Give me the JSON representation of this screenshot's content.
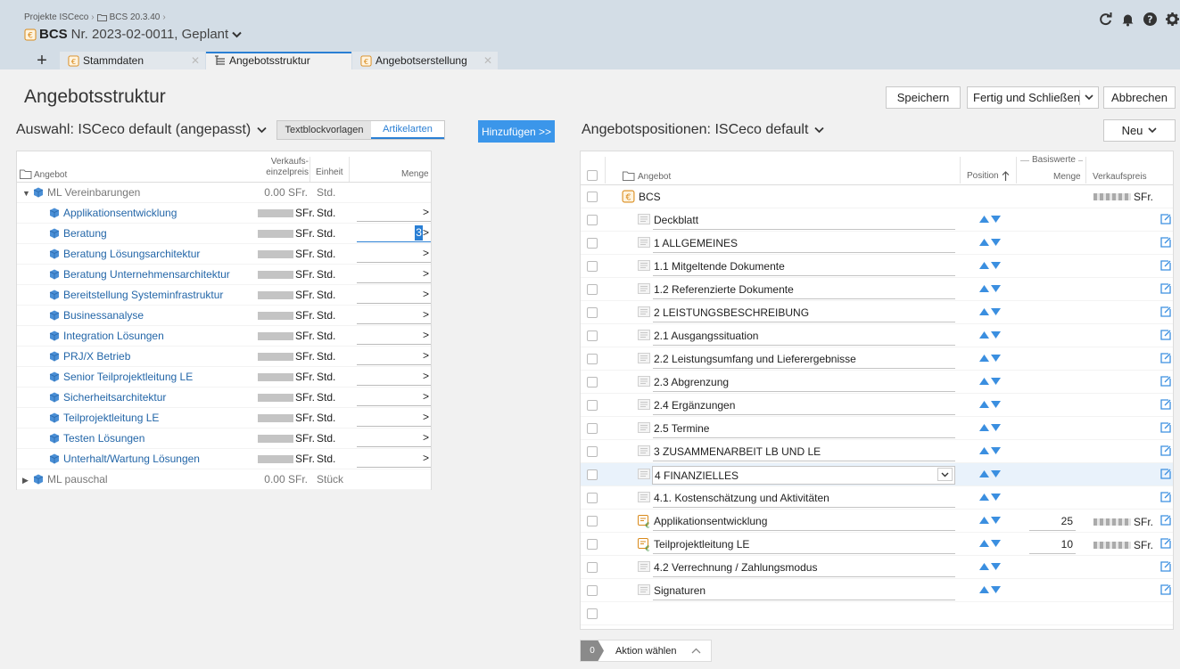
{
  "breadcrumb": {
    "items": [
      "Projekte ISCeco",
      "BCS 20.3.40"
    ]
  },
  "project": {
    "label": "BCS",
    "title": "Nr. 2023-02-0011, Geplant"
  },
  "header_icons": [
    "refresh-icon",
    "bell-icon",
    "help-icon",
    "gear-icon"
  ],
  "tabs": [
    {
      "label": "Stammdaten",
      "active": false
    },
    {
      "label": "Angebotsstruktur",
      "active": true
    },
    {
      "label": "Angebotserstellung",
      "active": false
    }
  ],
  "page": {
    "title": "Angebotsstruktur",
    "buttons": {
      "save": "Speichern",
      "finish": "Fertig und Schließen",
      "cancel": "Abbrechen"
    }
  },
  "left": {
    "selection_label": "Auswahl: ISCeco default (angepasst)",
    "segments": [
      "Textblockvorlagen",
      "Artikelarten"
    ],
    "active_segment": "Artikelarten",
    "add_button": "Hinzufügen >>",
    "columns": {
      "name": "Angebot",
      "price_1": "Verkaufs-",
      "price_2": "einzelpreis",
      "unit": "Einheit",
      "qty": "Menge"
    },
    "groups": [
      {
        "name": "ML Vereinbarungen",
        "price": "0.00 SFr.",
        "unit": "Std.",
        "expanded": true,
        "items": [
          {
            "name": "Applikationsentwicklung",
            "price_suffix": "SFr.",
            "unit": "Std.",
            "qty": ""
          },
          {
            "name": "Beratung",
            "price_suffix": "SFr.",
            "unit": "Std.",
            "qty": "3"
          },
          {
            "name": "Beratung Lösungsarchitektur",
            "price_suffix": "SFr.",
            "unit": "Std.",
            "qty": ""
          },
          {
            "name": "Beratung Unternehmensarchitektur",
            "price_suffix": "SFr.",
            "unit": "Std.",
            "qty": ""
          },
          {
            "name": "Bereitstellung Systeminfrastruktur",
            "price_suffix": "SFr.",
            "unit": "Std.",
            "qty": ""
          },
          {
            "name": "Businessanalyse",
            "price_suffix": "SFr.",
            "unit": "Std.",
            "qty": ""
          },
          {
            "name": "Integration Lösungen",
            "price_suffix": "SFr.",
            "unit": "Std.",
            "qty": ""
          },
          {
            "name": "PRJ/X Betrieb",
            "price_suffix": "SFr.",
            "unit": "Std.",
            "qty": ""
          },
          {
            "name": "Senior Teilprojektleitung LE",
            "price_suffix": "SFr.",
            "unit": "Std.",
            "qty": ""
          },
          {
            "name": "Sicherheitsarchitektur",
            "price_suffix": "SFr.",
            "unit": "Std.",
            "qty": ""
          },
          {
            "name": "Teilprojektleitung LE",
            "price_suffix": "SFr.",
            "unit": "Std.",
            "qty": ""
          },
          {
            "name": "Testen Lösungen",
            "price_suffix": "SFr.",
            "unit": "Std.",
            "qty": ""
          },
          {
            "name": "Unterhalt/Wartung Lösungen",
            "price_suffix": "SFr.",
            "unit": "Std.",
            "qty": ""
          }
        ]
      },
      {
        "name": "ML pauschal",
        "price": "0.00 SFr.",
        "unit": "Stück",
        "expanded": false,
        "items": []
      }
    ]
  },
  "right": {
    "title": "Angebotspositionen: ISCeco default",
    "new_button": "Neu",
    "columns": {
      "name": "Angebot",
      "position": "Position",
      "basiswerte": "Basiswerte",
      "menge": "Menge",
      "verkaufspreis": "Verkaufspreis"
    },
    "root": {
      "name": "BCS",
      "price_suffix": "SFr."
    },
    "rows": [
      {
        "name": "Deckblatt",
        "kind": "text"
      },
      {
        "name": "1 ALLGEMEINES",
        "kind": "text"
      },
      {
        "name": "1.1 Mitgeltende Dokumente",
        "kind": "text"
      },
      {
        "name": "1.2 Referenzierte Dokumente",
        "kind": "text"
      },
      {
        "name": "2 LEISTUNGSBESCHREIBUNG",
        "kind": "text"
      },
      {
        "name": "2.1 Ausgangssituation",
        "kind": "text"
      },
      {
        "name": "2.2 Leistungsumfang und Lieferergebnisse",
        "kind": "text"
      },
      {
        "name": "2.3 Abgrenzung",
        "kind": "text"
      },
      {
        "name": "2.4 Ergänzungen",
        "kind": "text"
      },
      {
        "name": "2.5 Termine",
        "kind": "text"
      },
      {
        "name": "3 ZUSAMMENARBEIT LB UND LE",
        "kind": "text"
      },
      {
        "name": "4 FINANZIELLES",
        "kind": "text",
        "selected": true
      },
      {
        "name": "4.1. Kostenschätzung und Aktivitäten",
        "kind": "text"
      },
      {
        "name": "Applikationsentwicklung",
        "kind": "article",
        "menge": "25",
        "price_suffix": "SFr."
      },
      {
        "name": "Teilprojektleitung LE",
        "kind": "article",
        "menge": "10",
        "price_suffix": "SFr."
      },
      {
        "name": "4.2 Verrechnung / Zahlungsmodus",
        "kind": "text"
      },
      {
        "name": "Signaturen",
        "kind": "text"
      }
    ],
    "action_count": "0",
    "action_label": "Aktion wählen"
  },
  "colors": {
    "accent": "#2a7fd4",
    "header_bg": "#d3dde6",
    "link": "#2366a8",
    "button_blue": "#3b96ea"
  }
}
